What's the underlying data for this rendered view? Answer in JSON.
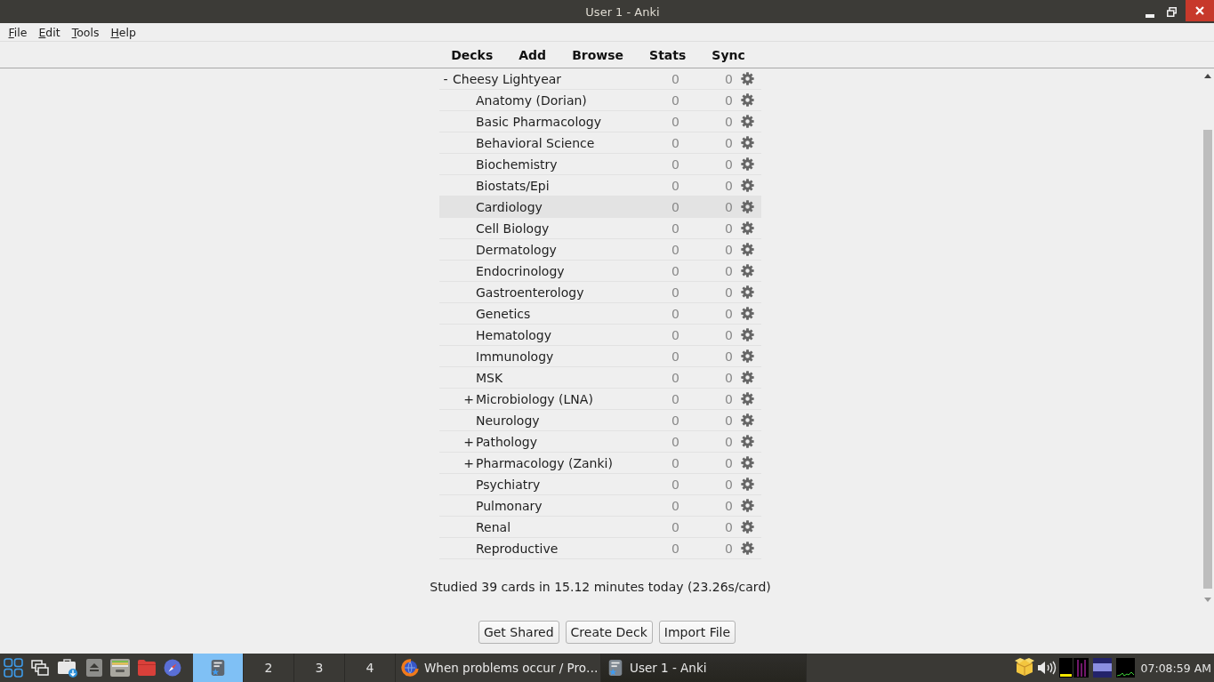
{
  "window": {
    "title": "User 1 - Anki"
  },
  "menu": [
    "File",
    "Edit",
    "Tools",
    "Help"
  ],
  "toolbar": [
    "Decks",
    "Add",
    "Browse",
    "Stats",
    "Sync"
  ],
  "decks": [
    {
      "name": "Cheesy Lightyear",
      "expander": "-",
      "column_2": "0",
      "column_3": "0",
      "selected": false,
      "children": [
        {
          "name": "Anatomy (Dorian)",
          "column_2": "0",
          "column_3": "0",
          "selected": false
        },
        {
          "name": "Basic Pharmacology",
          "column_2": "0",
          "column_3": "0",
          "selected": false
        },
        {
          "name": "Behavioral Science",
          "column_2": "0",
          "column_3": "0",
          "selected": false
        },
        {
          "name": "Biochemistry",
          "column_2": "0",
          "column_3": "0",
          "selected": false
        },
        {
          "name": "Biostats/Epi",
          "column_2": "0",
          "column_3": "0",
          "selected": false
        },
        {
          "name": "Cardiology",
          "column_2": "0",
          "column_3": "0",
          "selected": true
        },
        {
          "name": "Cell Biology",
          "column_2": "0",
          "column_3": "0",
          "selected": false
        },
        {
          "name": "Dermatology",
          "column_2": "0",
          "column_3": "0",
          "selected": false
        },
        {
          "name": "Endocrinology",
          "column_2": "0",
          "column_3": "0",
          "selected": false
        },
        {
          "name": "Gastroenterology",
          "column_2": "0",
          "column_3": "0",
          "selected": false
        },
        {
          "name": "Genetics",
          "column_2": "0",
          "column_3": "0",
          "selected": false
        },
        {
          "name": "Hematology",
          "column_2": "0",
          "column_3": "0",
          "selected": false
        },
        {
          "name": "Immunology",
          "column_2": "0",
          "column_3": "0",
          "selected": false
        },
        {
          "name": "MSK",
          "column_2": "0",
          "column_3": "0",
          "selected": false
        },
        {
          "name": "Microbiology (LNA)",
          "expander": "+",
          "column_2": "0",
          "column_3": "0",
          "selected": false
        },
        {
          "name": "Neurology",
          "column_2": "0",
          "column_3": "0",
          "selected": false
        },
        {
          "name": "Pathology",
          "expander": "+",
          "column_2": "0",
          "column_3": "0",
          "selected": false
        },
        {
          "name": "Pharmacology (Zanki)",
          "expander": "+",
          "column_2": "0",
          "column_3": "0",
          "selected": false
        },
        {
          "name": "Psychiatry",
          "column_2": "0",
          "column_3": "0",
          "selected": false
        },
        {
          "name": "Pulmonary",
          "column_2": "0",
          "column_3": "0",
          "selected": false
        },
        {
          "name": "Renal",
          "column_2": "0",
          "column_3": "0",
          "selected": false
        },
        {
          "name": "Reproductive",
          "column_2": "0",
          "column_3": "0",
          "selected": false
        }
      ]
    }
  ],
  "summary": "Studied 39 cards in 15.12 minutes today (23.26s/card)",
  "buttons": [
    "Get Shared",
    "Create Deck",
    "Import File"
  ],
  "taskbar": {
    "workspaces": [
      {
        "kind": "icon",
        "selected": true
      },
      {
        "kind": "number",
        "label": "2",
        "selected": false
      },
      {
        "kind": "number",
        "label": "3",
        "selected": false
      },
      {
        "kind": "number",
        "label": "4",
        "selected": false
      }
    ],
    "tasks": [
      {
        "kind": "browser",
        "label": "When problems occur / Pro…",
        "selected": false
      },
      {
        "kind": "app",
        "label": "User 1 - Anki",
        "selected": true
      }
    ],
    "clock": "07:08:59 AM"
  }
}
